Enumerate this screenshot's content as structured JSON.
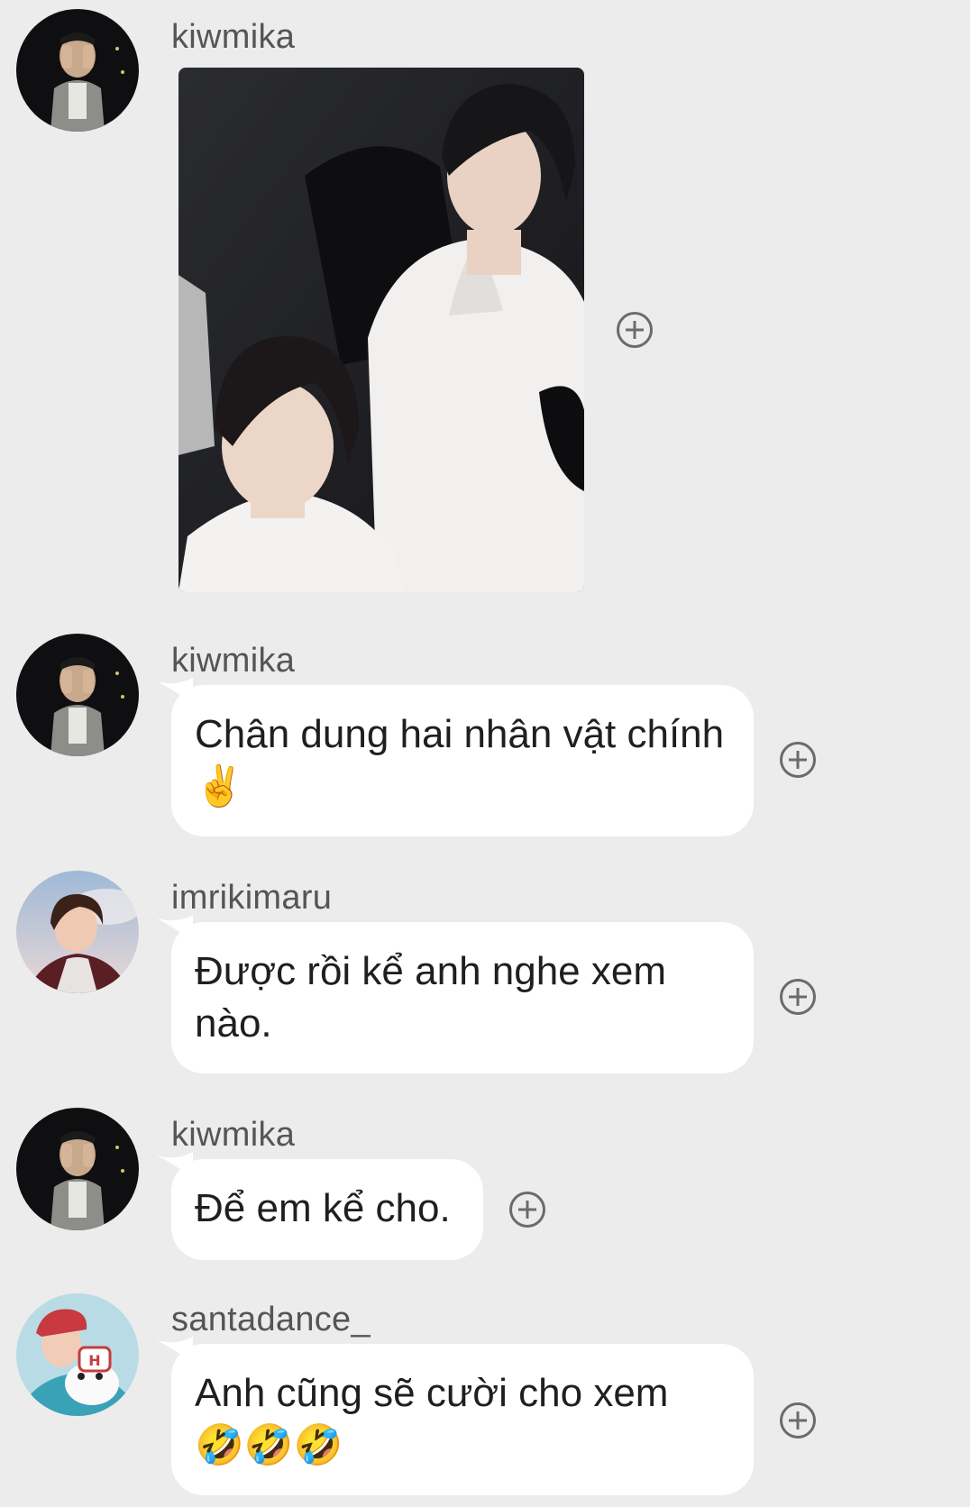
{
  "messages": [
    {
      "sender": "kiwmika",
      "type": "image",
      "image_alt": "photo-of-two-people-in-white-outfits"
    },
    {
      "sender": "kiwmika",
      "type": "text",
      "text": "Chân dung hai nhân vật chính ✌️"
    },
    {
      "sender": "imrikimaru",
      "type": "text",
      "text": "Được rồi kể anh nghe xem nào."
    },
    {
      "sender": "kiwmika",
      "type": "text",
      "text": "Để em kể cho."
    },
    {
      "sender": "santadance_",
      "type": "text",
      "text": "Anh cũng sẽ cười cho xem 🤣🤣🤣"
    }
  ],
  "icons": {
    "add_reaction": "plus-circle-icon"
  },
  "colors": {
    "background": "#ececec",
    "bubble": "#ffffff",
    "sender_text": "#555555"
  }
}
